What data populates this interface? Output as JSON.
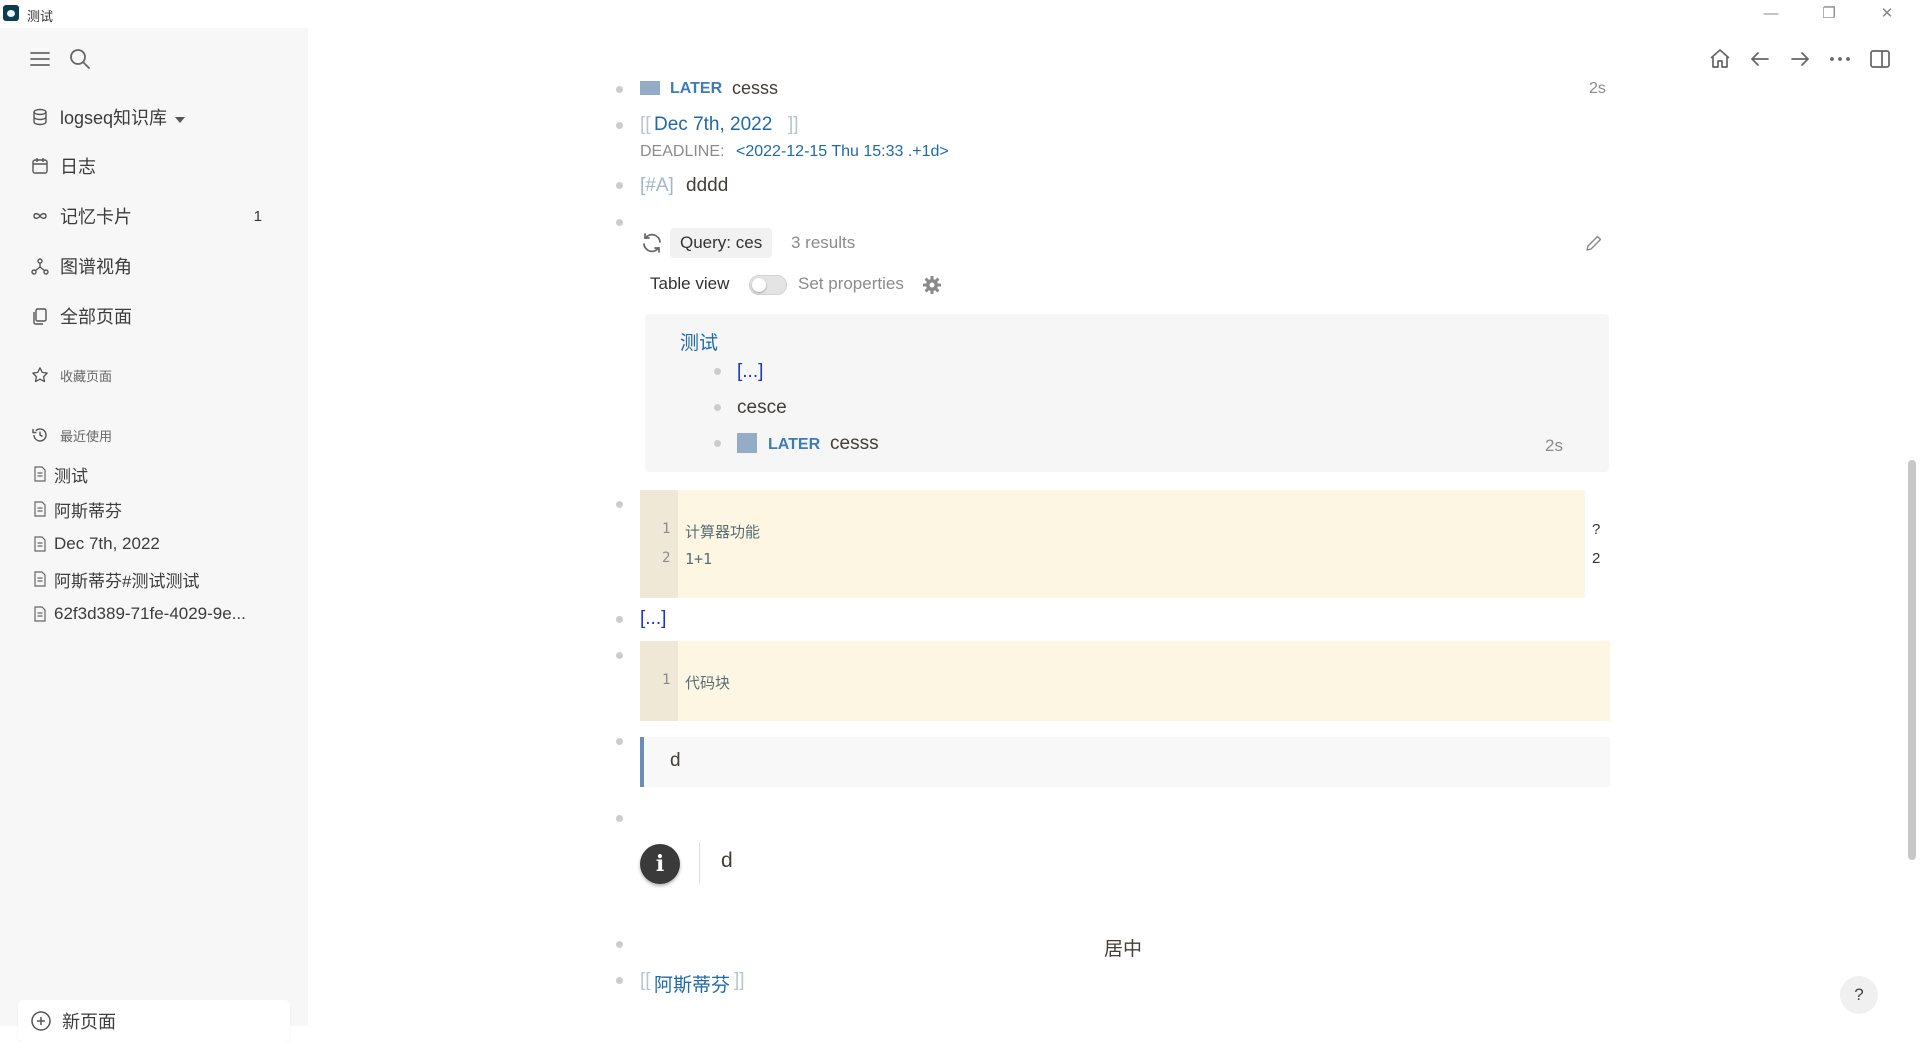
{
  "window": {
    "title": "测试",
    "minimize": "—",
    "restore": "❐",
    "close": "✕"
  },
  "sidebar": {
    "graph_name": "logseq知识库",
    "nav": [
      {
        "label": "日志",
        "icon": "calendar-icon"
      },
      {
        "label": "记忆卡片",
        "icon": "infinity-icon",
        "count": "1"
      },
      {
        "label": "图谱视角",
        "icon": "graph-icon"
      },
      {
        "label": "全部页面",
        "icon": "pages-icon"
      }
    ],
    "favorites_title": "收藏页面",
    "recent_title": "最近使用",
    "recent": [
      "测试",
      "阿斯蒂芬",
      "Dec 7th, 2022",
      "阿斯蒂芬#测试测试",
      "62f3d389-71fe-4029-9e..."
    ],
    "new_page": "新页面"
  },
  "content": {
    "top_later": "LATER",
    "top_later_text": "cesss",
    "top_time": "2s",
    "date_open": "[[",
    "date_link": "Dec 7th, 2022",
    "date_close": "]]",
    "deadline_label": "DEADLINE:",
    "deadline_value": "<2022-12-15 Thu 15:33 .+1d>",
    "priority": "[#A]",
    "priority_text": "dddd",
    "query_label": "Query: ces",
    "query_results": "3 results",
    "table_view": "Table view",
    "set_properties": "Set properties",
    "query_page": "测试",
    "query_items": [
      {
        "text": "[...]"
      },
      {
        "text": "cesce"
      },
      {
        "later": "LATER",
        "text": "cesss",
        "time": "2s"
      }
    ],
    "code1": {
      "lines": [
        {
          "n": "1",
          "code": "计算器功能",
          "result": "?"
        },
        {
          "n": "2",
          "code": "1+1",
          "result": "2"
        }
      ]
    },
    "ellipsis": "[...]",
    "code2": {
      "lines": [
        {
          "n": "1",
          "code": "代码块"
        }
      ]
    },
    "quote_text": "d",
    "info_icon": "i",
    "admonition_text": "d",
    "centered_text": "居中",
    "bottom_open": "[[",
    "bottom_link": "阿斯蒂芬",
    "bottom_close": "]]",
    "help": "?"
  }
}
